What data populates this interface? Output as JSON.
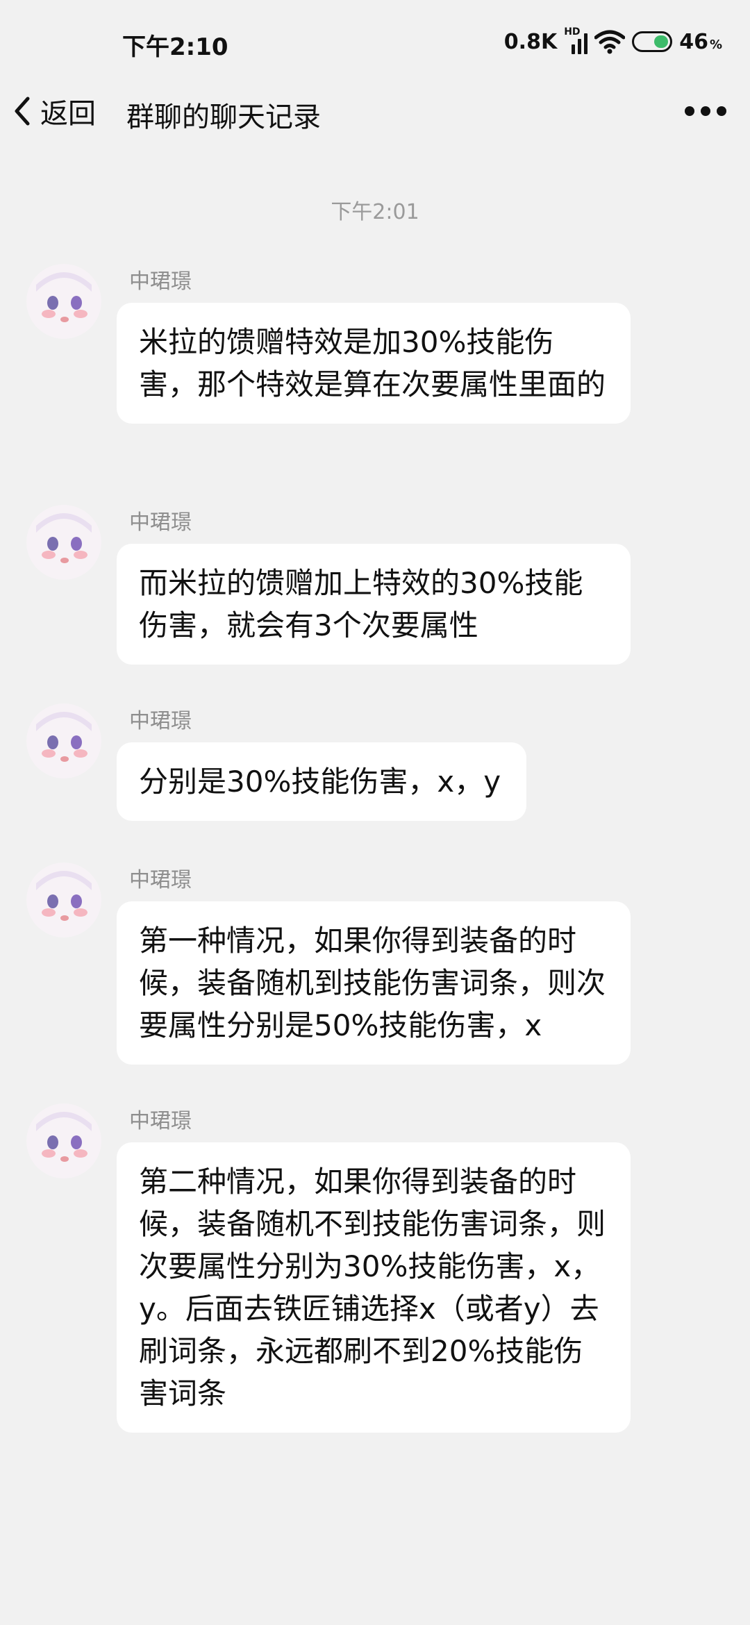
{
  "status_bar": {
    "time": "下午2:10",
    "net_speed": "0.8K",
    "hd": "HD",
    "battery_value": "46",
    "battery_unit": "%"
  },
  "header": {
    "back_label": "返回",
    "title": "群聊的聊天记录"
  },
  "timestamp": "下午2:01",
  "messages": [
    {
      "sender": "中珺璟",
      "text": "米拉的馈赠特效是加30%技能伤害，那个特效是算在次要属性里面的"
    },
    {
      "sender": "中珺璟",
      "text": "而米拉的馈赠加上特效的30%技能伤害，就会有3个次要属性"
    },
    {
      "sender": "中珺璟",
      "text": "分别是30%技能伤害，x，y"
    },
    {
      "sender": "中珺璟",
      "text": "第一种情况，如果你得到装备的时候，装备随机到技能伤害词条，则次要属性分别是50%技能伤害，x"
    },
    {
      "sender": "中珺璟",
      "text": "第二种情况，如果你得到装备的时候，装备随机不到技能伤害词条，则次要属性分别为30%技能伤害，x，y。后面去铁匠铺选择x（或者y）去刷词条，永远都刷不到20%技能伤害词条"
    }
  ],
  "colors": {
    "background": "#f1f1f1",
    "bubble": "#ffffff",
    "battery_fill": "#3dbb6a",
    "muted_text": "#9a9a9a"
  },
  "icons": [
    "back-chevron-icon",
    "more-icon",
    "signal-icon",
    "wifi-icon",
    "battery-icon",
    "avatar-image"
  ]
}
